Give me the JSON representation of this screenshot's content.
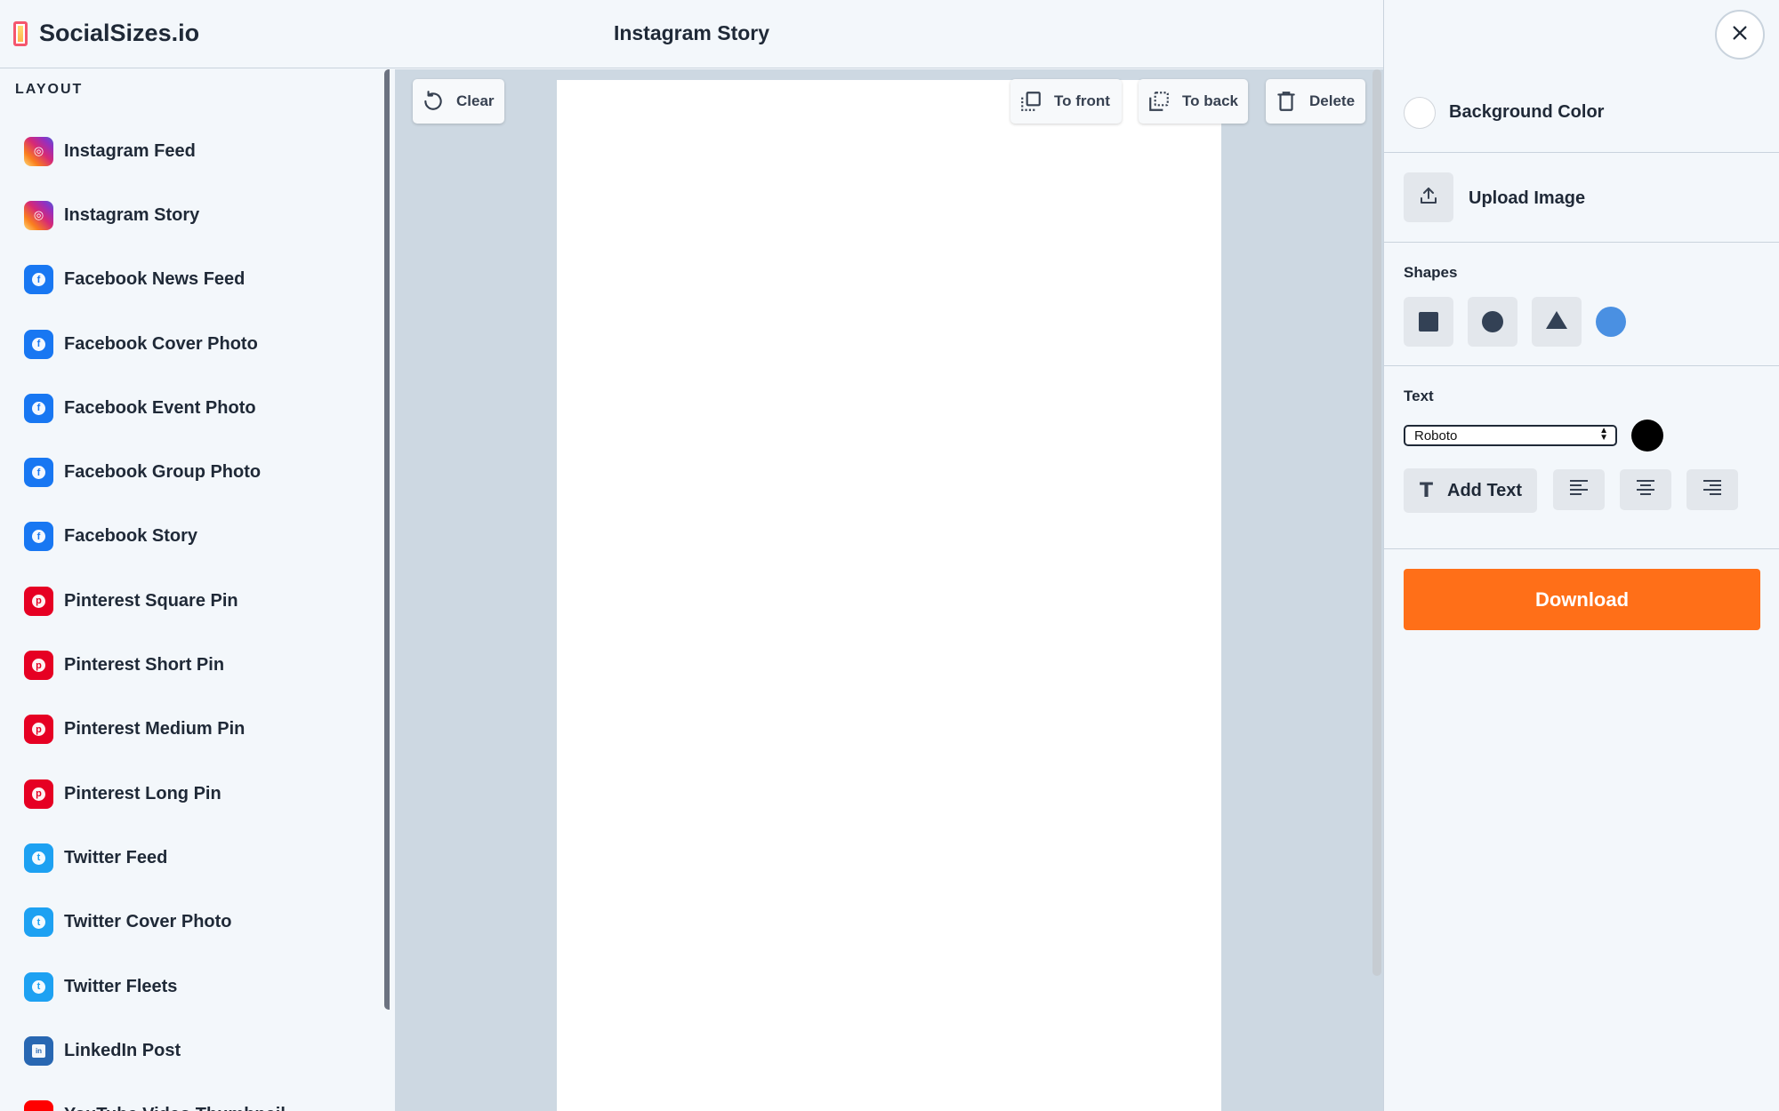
{
  "app": {
    "logo_text": "SocialSizes.io",
    "page_title": "Instagram Story"
  },
  "sidebar": {
    "heading": "LAYOUT",
    "items": [
      {
        "label": "Instagram Feed",
        "icon": "instagram-icon",
        "color": "#e1306c"
      },
      {
        "label": "Instagram Story",
        "icon": "instagram-icon",
        "color": "#e1306c"
      },
      {
        "label": "Facebook News Feed",
        "icon": "facebook-icon",
        "color": "#1877f2"
      },
      {
        "label": "Facebook Cover Photo",
        "icon": "facebook-icon",
        "color": "#1877f2"
      },
      {
        "label": "Facebook Event Photo",
        "icon": "facebook-icon",
        "color": "#1877f2"
      },
      {
        "label": "Facebook Group Photo",
        "icon": "facebook-icon",
        "color": "#1877f2"
      },
      {
        "label": "Facebook Story",
        "icon": "facebook-icon",
        "color": "#1877f2"
      },
      {
        "label": "Pinterest Square Pin",
        "icon": "pinterest-icon",
        "color": "#e60023"
      },
      {
        "label": "Pinterest Short Pin",
        "icon": "pinterest-icon",
        "color": "#e60023"
      },
      {
        "label": "Pinterest Medium Pin",
        "icon": "pinterest-icon",
        "color": "#e60023"
      },
      {
        "label": "Pinterest Long Pin",
        "icon": "pinterest-icon",
        "color": "#e60023"
      },
      {
        "label": "Twitter Feed",
        "icon": "twitter-icon",
        "color": "#1da1f2"
      },
      {
        "label": "Twitter Cover Photo",
        "icon": "twitter-icon",
        "color": "#1da1f2"
      },
      {
        "label": "Twitter Fleets",
        "icon": "twitter-icon",
        "color": "#1da1f2"
      },
      {
        "label": "LinkedIn Post",
        "icon": "linkedin-icon",
        "color": "#2867b2"
      },
      {
        "label": "YouTube Video Thumbnail",
        "icon": "youtube-icon",
        "color": "#ff0000"
      }
    ]
  },
  "toolbar": {
    "clear_label": "Clear",
    "to_front_label": "To front",
    "to_back_label": "To back",
    "delete_label": "Delete"
  },
  "panel": {
    "background_color_label": "Background Color",
    "background_color": "#ffffff",
    "upload_image_label": "Upload Image",
    "shapes_title": "Shapes",
    "shape_color": "#4a90e2",
    "text_title": "Text",
    "font_selected": "Roboto",
    "text_color": "#000000",
    "add_text_label": "Add Text",
    "download_label": "Download",
    "download_color": "#ff6f18"
  }
}
